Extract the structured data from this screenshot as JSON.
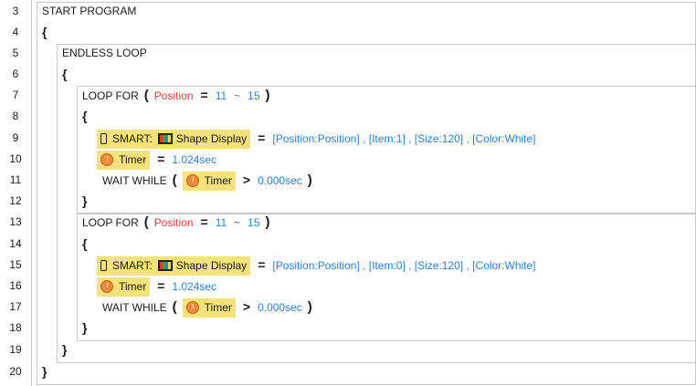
{
  "line_numbers": [
    "3",
    "4",
    "5",
    "6",
    "7",
    "8",
    "9",
    "10",
    "11",
    "12",
    "13",
    "14",
    "15",
    "16",
    "17",
    "18",
    "19",
    "20"
  ],
  "program": {
    "start": "START PROGRAM",
    "open_brace": "{",
    "close_brace": "}",
    "endless_loop": "ENDLESS LOOP",
    "loops": [
      {
        "keyword": "LOOP FOR",
        "open_paren": "(",
        "close_paren": ")",
        "variable": "Position",
        "equals": "=",
        "from": "11",
        "tilde": "~",
        "to": "15",
        "smart_label": "SMART:",
        "shape_display": "Shape Display",
        "params": "[Position:Position] , [Item:1] , [Size:120] , [Color:White]",
        "timer_label": "Timer",
        "timer_value": "1.024sec",
        "wait_keyword": "WAIT WHILE",
        "gt": ">",
        "wait_value": "0.000sec"
      },
      {
        "keyword": "LOOP FOR",
        "open_paren": "(",
        "close_paren": ")",
        "variable": "Position",
        "equals": "=",
        "from": "11",
        "tilde": "~",
        "to": "15",
        "smart_label": "SMART:",
        "shape_display": "Shape Display",
        "params": "[Position:Position] , [Item:0] , [Size:120] , [Color:White]",
        "timer_label": "Timer",
        "timer_value": "1.024sec",
        "wait_keyword": "WAIT WHILE",
        "gt": ">",
        "wait_value": "0.000sec"
      }
    ]
  }
}
